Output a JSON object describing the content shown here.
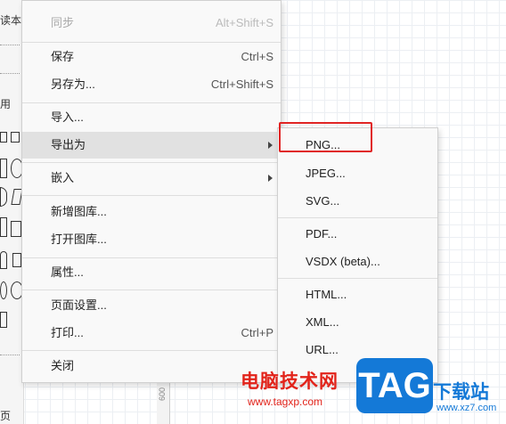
{
  "sidebar": {
    "label_top": "读本",
    "label_mid": "用",
    "label_bottom": "页"
  },
  "menu": {
    "items": [
      {
        "label": "同步",
        "shortcut": "Alt+Shift+S",
        "disabled": true
      },
      {
        "label": "保存",
        "shortcut": "Ctrl+S"
      },
      {
        "label": "另存为...",
        "shortcut": "Ctrl+Shift+S"
      },
      {
        "label": "导入..."
      },
      {
        "label": "导出为",
        "submenu": true,
        "active": true
      },
      {
        "label": "嵌入",
        "submenu": true
      },
      {
        "label": "新增图库..."
      },
      {
        "label": "打开图库..."
      },
      {
        "label": "属性..."
      },
      {
        "label": "页面设置..."
      },
      {
        "label": "打印...",
        "shortcut": "Ctrl+P"
      },
      {
        "label": "关闭"
      }
    ]
  },
  "submenu": {
    "items": [
      {
        "label": "PNG...",
        "highlighted": true
      },
      {
        "label": "JPEG..."
      },
      {
        "label": "SVG..."
      },
      {
        "label": "PDF..."
      },
      {
        "label": "VSDX (beta)..."
      },
      {
        "label": "HTML..."
      },
      {
        "label": "XML..."
      },
      {
        "label": "URL..."
      }
    ]
  },
  "ruler": {
    "value": "600"
  },
  "watermark": {
    "site_cn": "电脑技术网",
    "site_url": "www.tagxp.com",
    "logo": "TAG",
    "download_cn": "下载站",
    "download_url": "www.xz7.com"
  },
  "colors": {
    "highlight": "#e02424",
    "brand_blue": "#1479d7"
  }
}
